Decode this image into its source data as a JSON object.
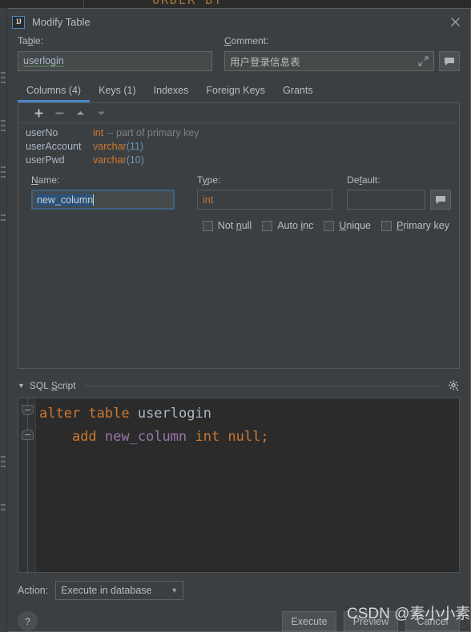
{
  "background": {
    "sql_fragment": "ORDER BY"
  },
  "dialog": {
    "title": "Modify Table",
    "logo_text": "IJ",
    "close_icon": "close-icon"
  },
  "form": {
    "table_label": "Ta<u>b</u>le:",
    "table_value": "userlogin",
    "comment_label": "<u>C</u>omment:",
    "comment_value": "用户登录信息表",
    "expand_icon": "expand-icon",
    "comment_button_icon": "speech-bubble-icon"
  },
  "tabs": [
    {
      "label": "Columns (4)",
      "active": true
    },
    {
      "label": "Keys (1)",
      "active": false
    },
    {
      "label": "Indexes",
      "active": false
    },
    {
      "label": "Foreign Keys",
      "active": false
    },
    {
      "label": "Grants",
      "active": false
    }
  ],
  "toolbar": [
    {
      "name": "add-column-button",
      "icon": "plus-icon"
    },
    {
      "name": "remove-column-button",
      "icon": "minus-icon"
    },
    {
      "name": "move-up-button",
      "icon": "arrow-up-icon"
    },
    {
      "name": "move-down-button",
      "icon": "arrow-down-icon"
    }
  ],
  "columns": [
    {
      "name": "userNo",
      "type": "int",
      "paren": "",
      "note": "-- part of primary key"
    },
    {
      "name": "userAccount",
      "type": "varchar",
      "paren": "(11)",
      "note": ""
    },
    {
      "name": "userPwd",
      "type": "varchar",
      "paren": "(10)",
      "note": ""
    }
  ],
  "editor": {
    "name_label": "<u>N</u>ame:",
    "name_value": "new_column",
    "type_label": "T<u>y</u>pe:",
    "type_value": "int",
    "default_label": "De<u>f</u>ault:",
    "default_value": "",
    "default_button_icon": "speech-bubble-icon"
  },
  "checkboxes": [
    {
      "label": "Not <u>n</u>ull",
      "checked": false,
      "name": "not-null-checkbox"
    },
    {
      "label": "Auto <u>i</u>nc",
      "checked": false,
      "name": "auto-inc-checkbox"
    },
    {
      "label": "<u>U</u>nique",
      "checked": false,
      "name": "unique-checkbox"
    },
    {
      "label": "<u>P</u>rimary key",
      "checked": false,
      "name": "primary-key-checkbox"
    }
  ],
  "sql": {
    "section_title": "SQL <u>S</u>cript",
    "collapse_icon": "chevron-down-icon",
    "settings_icon": "gear-icon",
    "line1": [
      {
        "t": "alter table ",
        "c": "kw"
      },
      {
        "t": "userlogin",
        "c": "ident"
      }
    ],
    "line2": [
      {
        "t": "    add ",
        "c": "kw"
      },
      {
        "t": "new_column",
        "c": "colname"
      },
      {
        "t": " int null;",
        "c": "kw"
      }
    ],
    "plain_text": "alter table userlogin\n    add new_column int null;"
  },
  "action": {
    "label": "Action:",
    "value": "Execute in database",
    "caret_icon": "chevron-down-icon"
  },
  "footer": {
    "help_label": "?",
    "buttons": [
      {
        "label": "Execute",
        "name": "execute-button"
      },
      {
        "label": "Preview",
        "name": "preview-button"
      },
      {
        "label": "Cancel",
        "name": "cancel-button"
      }
    ]
  },
  "watermark": {
    "text": "CSDN @素小小素"
  },
  "colors": {
    "accent": "#4a88c7",
    "panel_bg": "#3c3f41",
    "editor_bg": "#2b2b2b",
    "text": "#bbbbbb",
    "keyword": "#cc7832",
    "identifier": "#a9b7c6",
    "column_name": "#9876aa",
    "number": "#6897bb",
    "comment": "#808080"
  }
}
